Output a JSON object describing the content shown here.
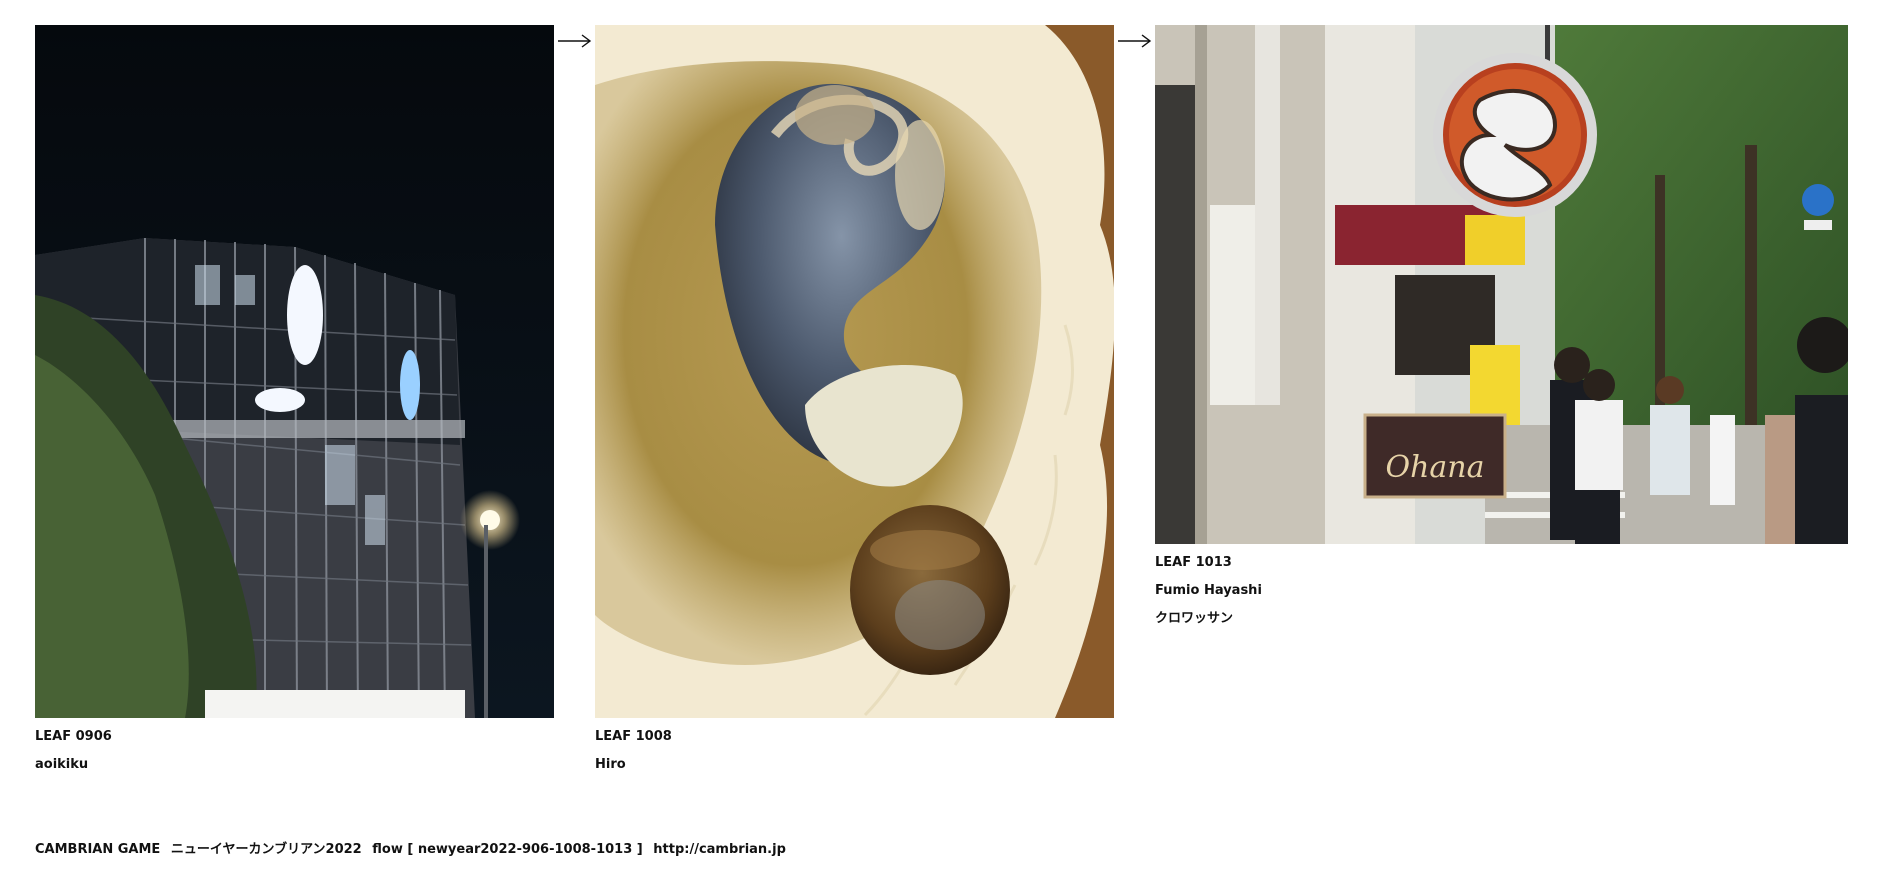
{
  "arrow_glyph": "arrow-right-icon",
  "items": [
    {
      "leaf": "LEAF 0906",
      "author": "aoikiku",
      "title": "",
      "image_subject": "night-building-photo"
    },
    {
      "leaf": "LEAF 1008",
      "author": "Hiro",
      "title": "",
      "image_subject": "turban-shell-dish-photo"
    },
    {
      "leaf": "LEAF 1013",
      "author": "Fumio Hayashi",
      "title": "クロワッサン",
      "image_subject": "croissant-street-sign-photo",
      "sign_text": "Ohana"
    }
  ],
  "footer": {
    "game": "CAMBRIAN GAME",
    "event": "ニューイヤーカンブリアン2022",
    "flow": "flow [ newyear2022-906-1008-1013 ]",
    "url": "http://cambrian.jp"
  },
  "colors": {
    "text": "#111111",
    "background": "#ffffff"
  }
}
